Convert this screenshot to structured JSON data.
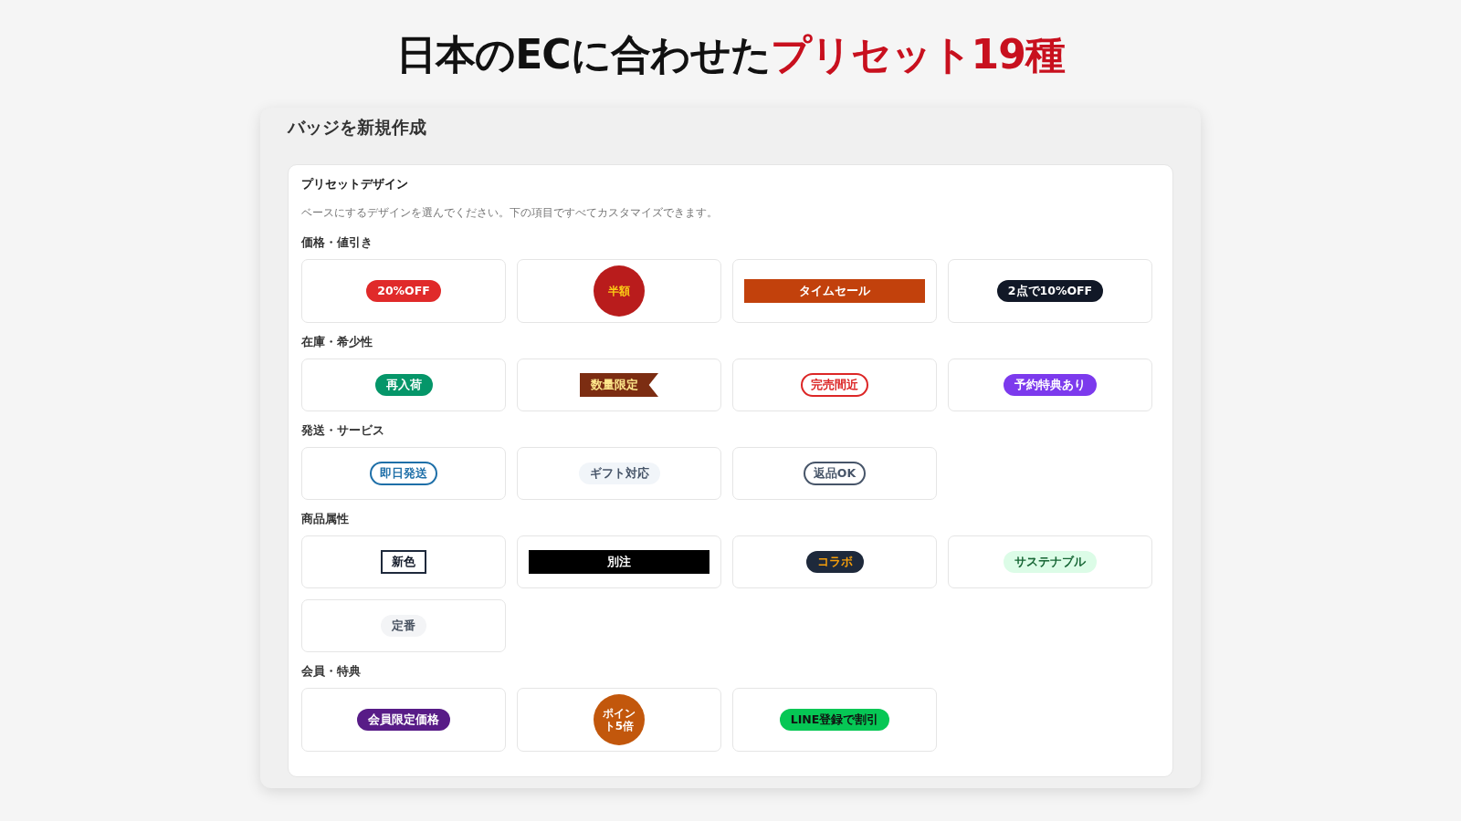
{
  "headline": {
    "lead": "日本のECに合わせた",
    "accent": "プリセット19種"
  },
  "dialog": {
    "title": "バッジを新規作成"
  },
  "preset": {
    "title": "プリセットデザイン",
    "description": "ベースにするデザインを選んでください。下の項目ですべてカスタマイズできます。",
    "groups": [
      {
        "label": "価格・値引き",
        "badges": [
          {
            "kind": "pill",
            "color": "#e02a2a",
            "label": {
              "text": "20%OFF",
              "color": "#ffffff"
            }
          },
          {
            "kind": "circle",
            "color": "#b91c1c",
            "label": {
              "text": "半額",
              "color": "#facc15"
            }
          },
          {
            "kind": "bar",
            "color": "#c2410c",
            "label": {
              "text": "タイムセール",
              "color": "#ffffff"
            }
          },
          {
            "kind": "pill",
            "color": "#111827",
            "label": {
              "text": "2点で10%OFF",
              "color": "#ffffff"
            }
          }
        ]
      },
      {
        "label": "在庫・希少性",
        "badges": [
          {
            "kind": "pill",
            "color": "#059669",
            "label": {
              "text": "再入荷",
              "color": "#ffffff"
            }
          },
          {
            "kind": "ribbon",
            "color": "#7c2d12",
            "label": {
              "text": "数量限定",
              "color": "#fde68a"
            }
          },
          {
            "kind": "outline",
            "color": "#dc2626",
            "label": {
              "text": "完売間近",
              "color": "#dc2626"
            }
          },
          {
            "kind": "pill",
            "color": "#7c3aed",
            "label": {
              "text": "予約特典あり",
              "color": "#ffffff"
            }
          }
        ]
      },
      {
        "label": "発送・サービス",
        "badges": [
          {
            "kind": "outline",
            "color": "#1e6fa8",
            "label": {
              "text": "即日発送",
              "color": "#1e6fa8"
            }
          },
          {
            "kind": "pill",
            "color": "#f1f5f9",
            "label": {
              "text": "ギフト対応",
              "color": "#475569"
            }
          },
          {
            "kind": "outline",
            "color": "#475569",
            "label": {
              "text": "返品OK",
              "color": "#475569"
            }
          }
        ]
      },
      {
        "label": "商品属性",
        "badges": [
          {
            "kind": "box",
            "color": "#1e293b",
            "label": {
              "text": "新色",
              "color": "#111827"
            }
          },
          {
            "kind": "bar",
            "color": "#000000",
            "label": {
              "text": "別注",
              "color": "#ffffff"
            }
          },
          {
            "kind": "pill",
            "color": "#1e293b",
            "label": {
              "text": "コラボ",
              "color": "#f59e0b"
            }
          },
          {
            "kind": "pill",
            "color": "#dcfce7",
            "label": {
              "text": "サステナブル",
              "color": "#166534"
            }
          },
          {
            "kind": "pill",
            "color": "#f3f4f6",
            "label": {
              "text": "定番",
              "color": "#4b5563"
            }
          }
        ]
      },
      {
        "label": "会員・特典",
        "badges": [
          {
            "kind": "pill",
            "color": "#581c87",
            "label": {
              "text": "会員限定価格",
              "color": "#ffffff"
            }
          },
          {
            "kind": "circle",
            "color": "#c2570c",
            "label": {
              "text": "ポイント5倍",
              "color": "#ffffff"
            }
          },
          {
            "kind": "pill",
            "color": "#06c755",
            "label": {
              "text": "LINE登録で割引",
              "color": "#111111"
            }
          }
        ]
      }
    ]
  }
}
